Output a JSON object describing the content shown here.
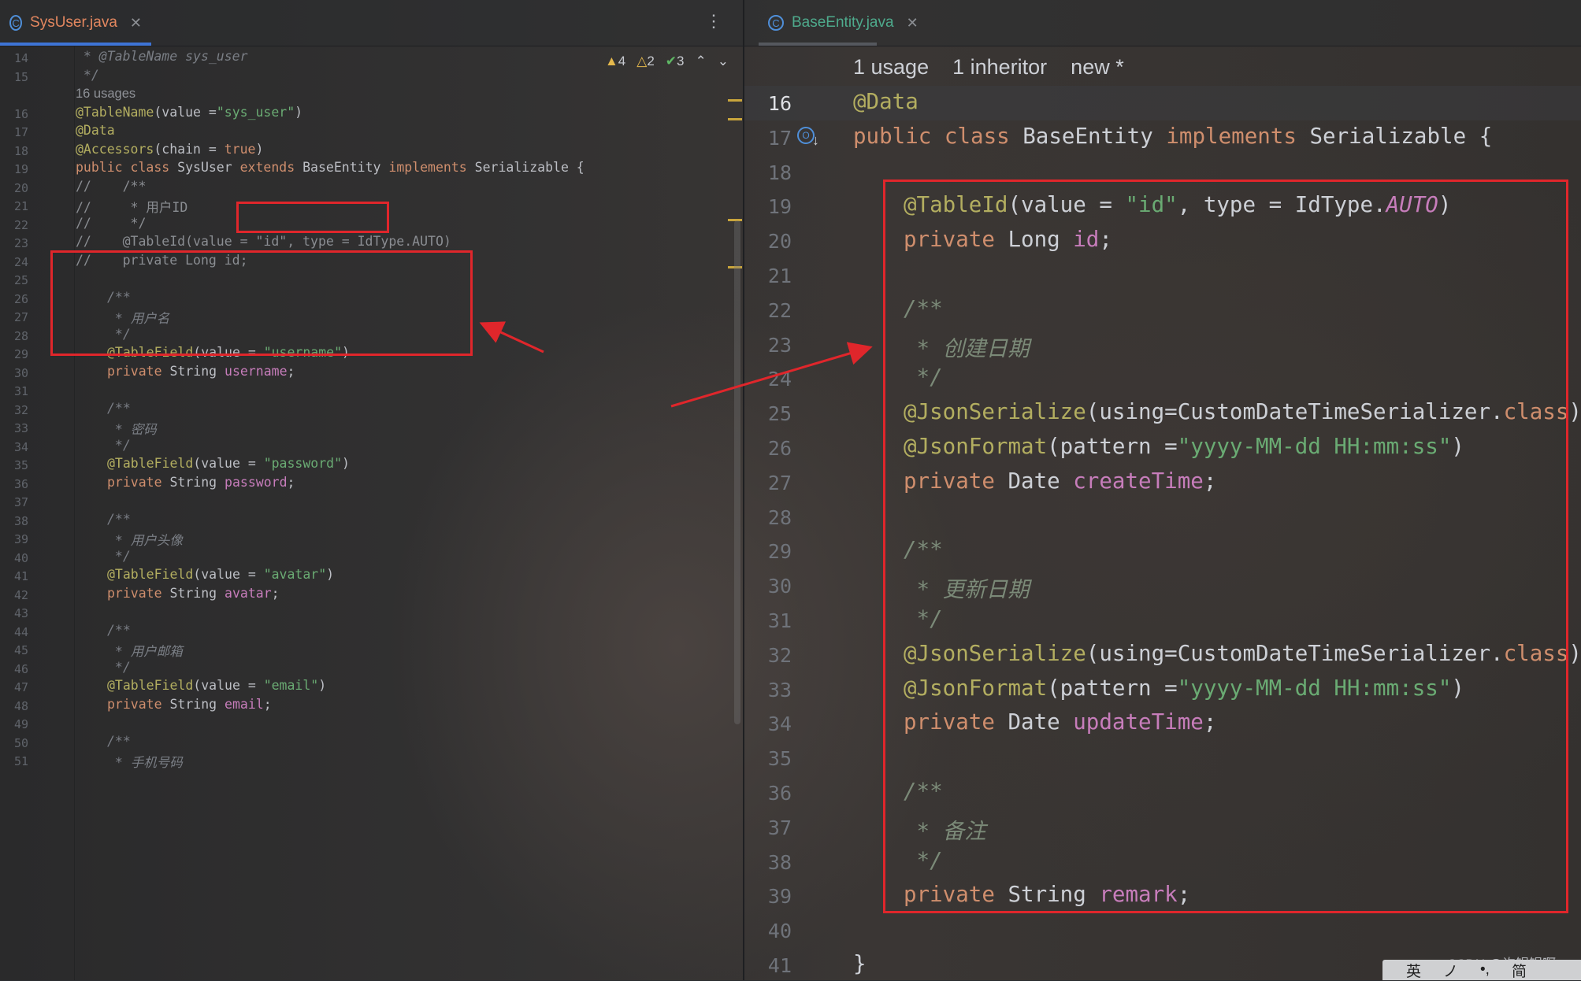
{
  "left_tab": {
    "title": "SysUser.java"
  },
  "right_tab": {
    "title": "BaseEntity.java"
  },
  "inspections": {
    "warnings_1": "4",
    "warnings_2": "2",
    "passed": "3"
  },
  "left_editor": {
    "lines": [
      {
        "n": "14",
        "segs": [
          {
            "c": "cm",
            "t": " * @TableName sys_user"
          }
        ],
        "indent": 0
      },
      {
        "n": "15",
        "segs": [
          {
            "c": "cm",
            "t": " */"
          }
        ],
        "indent": 0
      },
      {
        "n": "",
        "segs": [
          {
            "c": "hint",
            "t": "16 usages"
          }
        ],
        "indent": 0
      },
      {
        "n": "16",
        "segs": [
          {
            "c": "an",
            "t": "@TableName"
          },
          {
            "c": "",
            "t": "(value ="
          },
          {
            "c": "st",
            "t": "\"sys_user\""
          },
          {
            "c": "",
            "t": ")"
          }
        ],
        "indent": 0
      },
      {
        "n": "17",
        "segs": [
          {
            "c": "an",
            "t": "@Data"
          }
        ],
        "indent": 0
      },
      {
        "n": "18",
        "segs": [
          {
            "c": "an",
            "t": "@Accessors"
          },
          {
            "c": "",
            "t": "(chain = "
          },
          {
            "c": "kw",
            "t": "true"
          },
          {
            "c": "",
            "t": ")"
          }
        ],
        "indent": 0
      },
      {
        "n": "19",
        "segs": [
          {
            "c": "kw",
            "t": "public class "
          },
          {
            "c": "",
            "t": "SysUser "
          },
          {
            "c": "kw",
            "t": "extends "
          },
          {
            "c": "",
            "t": "BaseEntity "
          },
          {
            "c": "kw",
            "t": "implements "
          },
          {
            "c": "",
            "t": "Serializable {"
          }
        ],
        "indent": 0
      },
      {
        "n": "20",
        "segs": [
          {
            "c": "lcm",
            "t": "//    /**"
          }
        ],
        "indent": 0
      },
      {
        "n": "21",
        "segs": [
          {
            "c": "lcm",
            "t": "//     * 用户ID"
          }
        ],
        "indent": 0
      },
      {
        "n": "22",
        "segs": [
          {
            "c": "lcm",
            "t": "//     */"
          }
        ],
        "indent": 0
      },
      {
        "n": "23",
        "segs": [
          {
            "c": "lcm",
            "t": "//    @TableId(value = \"id\", type = IdType.AUTO)"
          }
        ],
        "indent": 0
      },
      {
        "n": "24",
        "segs": [
          {
            "c": "lcm",
            "t": "//    private Long id;"
          }
        ],
        "indent": 0
      },
      {
        "n": "25",
        "segs": [],
        "indent": 0
      },
      {
        "n": "26",
        "segs": [
          {
            "c": "cm",
            "t": "/**"
          }
        ],
        "indent": 1
      },
      {
        "n": "27",
        "segs": [
          {
            "c": "cm",
            "t": " * 用户名"
          }
        ],
        "indent": 1
      },
      {
        "n": "28",
        "segs": [
          {
            "c": "cm",
            "t": " */"
          }
        ],
        "indent": 1
      },
      {
        "n": "29",
        "segs": [
          {
            "c": "an",
            "t": "@TableField"
          },
          {
            "c": "",
            "t": "(value = "
          },
          {
            "c": "st",
            "t": "\"username\""
          },
          {
            "c": "",
            "t": ")"
          }
        ],
        "indent": 1
      },
      {
        "n": "30",
        "segs": [
          {
            "c": "kw",
            "t": "private "
          },
          {
            "c": "",
            "t": "String "
          },
          {
            "c": "fd",
            "t": "username"
          },
          {
            "c": "",
            "t": ";"
          }
        ],
        "indent": 1
      },
      {
        "n": "31",
        "segs": [],
        "indent": 0
      },
      {
        "n": "32",
        "segs": [
          {
            "c": "cm",
            "t": "/**"
          }
        ],
        "indent": 1
      },
      {
        "n": "33",
        "segs": [
          {
            "c": "cm",
            "t": " * 密码"
          }
        ],
        "indent": 1
      },
      {
        "n": "34",
        "segs": [
          {
            "c": "cm",
            "t": " */"
          }
        ],
        "indent": 1
      },
      {
        "n": "35",
        "segs": [
          {
            "c": "an",
            "t": "@TableField"
          },
          {
            "c": "",
            "t": "(value = "
          },
          {
            "c": "st",
            "t": "\"password\""
          },
          {
            "c": "",
            "t": ")"
          }
        ],
        "indent": 1
      },
      {
        "n": "36",
        "segs": [
          {
            "c": "kw",
            "t": "private "
          },
          {
            "c": "",
            "t": "String "
          },
          {
            "c": "fd",
            "t": "password"
          },
          {
            "c": "",
            "t": ";"
          }
        ],
        "indent": 1
      },
      {
        "n": "37",
        "segs": [],
        "indent": 0
      },
      {
        "n": "38",
        "segs": [
          {
            "c": "cm",
            "t": "/**"
          }
        ],
        "indent": 1
      },
      {
        "n": "39",
        "segs": [
          {
            "c": "cm",
            "t": " * 用户头像"
          }
        ],
        "indent": 1
      },
      {
        "n": "40",
        "segs": [
          {
            "c": "cm",
            "t": " */"
          }
        ],
        "indent": 1
      },
      {
        "n": "41",
        "segs": [
          {
            "c": "an",
            "t": "@TableField"
          },
          {
            "c": "",
            "t": "(value = "
          },
          {
            "c": "st",
            "t": "\"avatar\""
          },
          {
            "c": "",
            "t": ")"
          }
        ],
        "indent": 1
      },
      {
        "n": "42",
        "segs": [
          {
            "c": "kw",
            "t": "private "
          },
          {
            "c": "",
            "t": "String "
          },
          {
            "c": "fd",
            "t": "avatar"
          },
          {
            "c": "",
            "t": ";"
          }
        ],
        "indent": 1
      },
      {
        "n": "43",
        "segs": [],
        "indent": 0
      },
      {
        "n": "44",
        "segs": [
          {
            "c": "cm",
            "t": "/**"
          }
        ],
        "indent": 1
      },
      {
        "n": "45",
        "segs": [
          {
            "c": "cm",
            "t": " * 用户邮箱"
          }
        ],
        "indent": 1
      },
      {
        "n": "46",
        "segs": [
          {
            "c": "cm",
            "t": " */"
          }
        ],
        "indent": 1
      },
      {
        "n": "47",
        "segs": [
          {
            "c": "an",
            "t": "@TableField"
          },
          {
            "c": "",
            "t": "(value = "
          },
          {
            "c": "st",
            "t": "\"email\""
          },
          {
            "c": "",
            "t": ")"
          }
        ],
        "indent": 1
      },
      {
        "n": "48",
        "segs": [
          {
            "c": "kw",
            "t": "private "
          },
          {
            "c": "",
            "t": "String "
          },
          {
            "c": "fd",
            "t": "email"
          },
          {
            "c": "",
            "t": ";"
          }
        ],
        "indent": 1
      },
      {
        "n": "49",
        "segs": [],
        "indent": 0
      },
      {
        "n": "50",
        "segs": [
          {
            "c": "cm",
            "t": "/**"
          }
        ],
        "indent": 1
      },
      {
        "n": "51",
        "segs": [
          {
            "c": "cm",
            "t": " * 手机号码"
          }
        ],
        "indent": 1
      }
    ]
  },
  "right_editor": {
    "hints": [
      "1 usage",
      "1 inheritor",
      "new *"
    ],
    "current_line": "16",
    "lines": [
      {
        "n": "16",
        "segs": [
          {
            "c": "an",
            "t": "@Data"
          }
        ],
        "indent": 0
      },
      {
        "n": "17",
        "segs": [
          {
            "c": "kw",
            "t": "public class "
          },
          {
            "c": "",
            "t": "BaseEntity "
          },
          {
            "c": "kw",
            "t": "implements "
          },
          {
            "c": "",
            "t": "Serializable {"
          }
        ],
        "indent": 0
      },
      {
        "n": "18",
        "segs": [],
        "indent": 0
      },
      {
        "n": "19",
        "segs": [
          {
            "c": "an",
            "t": "@TableId"
          },
          {
            "c": "",
            "t": "(value = "
          },
          {
            "c": "st",
            "t": "\"id\""
          },
          {
            "c": "",
            "t": ", type = IdType."
          },
          {
            "c": "fdi",
            "t": "AUTO"
          },
          {
            "c": "",
            "t": ")"
          }
        ],
        "indent": 1
      },
      {
        "n": "20",
        "segs": [
          {
            "c": "kw",
            "t": "private "
          },
          {
            "c": "",
            "t": "Long "
          },
          {
            "c": "fd",
            "t": "id"
          },
          {
            "c": "",
            "t": ";"
          }
        ],
        "indent": 1
      },
      {
        "n": "21",
        "segs": [],
        "indent": 0
      },
      {
        "n": "22",
        "segs": [
          {
            "c": "cm",
            "t": "/**"
          }
        ],
        "indent": 1
      },
      {
        "n": "23",
        "segs": [
          {
            "c": "cm",
            "t": " * 创建日期"
          }
        ],
        "indent": 1
      },
      {
        "n": "24",
        "segs": [
          {
            "c": "cm",
            "t": " */"
          }
        ],
        "indent": 1
      },
      {
        "n": "25",
        "segs": [
          {
            "c": "an",
            "t": "@JsonSerialize"
          },
          {
            "c": "",
            "t": "(using=CustomDateTimeSerializer."
          },
          {
            "c": "kw",
            "t": "class"
          },
          {
            "c": "",
            "t": ")"
          }
        ],
        "indent": 1
      },
      {
        "n": "26",
        "segs": [
          {
            "c": "an",
            "t": "@JsonFormat"
          },
          {
            "c": "",
            "t": "(pattern ="
          },
          {
            "c": "st",
            "t": "\"yyyy-MM-dd HH:mm:ss\""
          },
          {
            "c": "",
            "t": ")"
          }
        ],
        "indent": 1
      },
      {
        "n": "27",
        "segs": [
          {
            "c": "kw",
            "t": "private "
          },
          {
            "c": "",
            "t": "Date "
          },
          {
            "c": "fd",
            "t": "createTime"
          },
          {
            "c": "",
            "t": ";"
          }
        ],
        "indent": 1
      },
      {
        "n": "28",
        "segs": [],
        "indent": 0
      },
      {
        "n": "29",
        "segs": [
          {
            "c": "cm",
            "t": "/**"
          }
        ],
        "indent": 1
      },
      {
        "n": "30",
        "segs": [
          {
            "c": "cm",
            "t": " * 更新日期"
          }
        ],
        "indent": 1
      },
      {
        "n": "31",
        "segs": [
          {
            "c": "cm",
            "t": " */"
          }
        ],
        "indent": 1
      },
      {
        "n": "32",
        "segs": [
          {
            "c": "an",
            "t": "@JsonSerialize"
          },
          {
            "c": "",
            "t": "(using=CustomDateTimeSerializer."
          },
          {
            "c": "kw",
            "t": "class"
          },
          {
            "c": "",
            "t": ")"
          }
        ],
        "indent": 1
      },
      {
        "n": "33",
        "segs": [
          {
            "c": "an",
            "t": "@JsonFormat"
          },
          {
            "c": "",
            "t": "(pattern ="
          },
          {
            "c": "st",
            "t": "\"yyyy-MM-dd HH:mm:ss\""
          },
          {
            "c": "",
            "t": ")"
          }
        ],
        "indent": 1
      },
      {
        "n": "34",
        "segs": [
          {
            "c": "kw",
            "t": "private "
          },
          {
            "c": "",
            "t": "Date "
          },
          {
            "c": "fd",
            "t": "updateTime"
          },
          {
            "c": "",
            "t": ";"
          }
        ],
        "indent": 1
      },
      {
        "n": "35",
        "segs": [],
        "indent": 0
      },
      {
        "n": "36",
        "segs": [
          {
            "c": "cm",
            "t": "/**"
          }
        ],
        "indent": 1
      },
      {
        "n": "37",
        "segs": [
          {
            "c": "cm",
            "t": " * 备注"
          }
        ],
        "indent": 1
      },
      {
        "n": "38",
        "segs": [
          {
            "c": "cm",
            "t": " */"
          }
        ],
        "indent": 1
      },
      {
        "n": "39",
        "segs": [
          {
            "c": "kw",
            "t": "private "
          },
          {
            "c": "",
            "t": "String "
          },
          {
            "c": "fd",
            "t": "remark"
          },
          {
            "c": "",
            "t": ";"
          }
        ],
        "indent": 1
      },
      {
        "n": "40",
        "segs": [],
        "indent": 0
      },
      {
        "n": "41",
        "segs": [
          {
            "c": "",
            "t": "}"
          }
        ],
        "indent": 0
      }
    ]
  },
  "watermark": "CSDN @许锅锅啊",
  "ime_bar": [
    "英",
    "ノ",
    "•,",
    "简"
  ],
  "colors": {
    "keyword": "#cf8e6d",
    "annotation": "#b3ae60",
    "string": "#6aab73",
    "field": "#c77dbb",
    "comment": "#7a7e85",
    "highlight_box": "#e0262b"
  }
}
